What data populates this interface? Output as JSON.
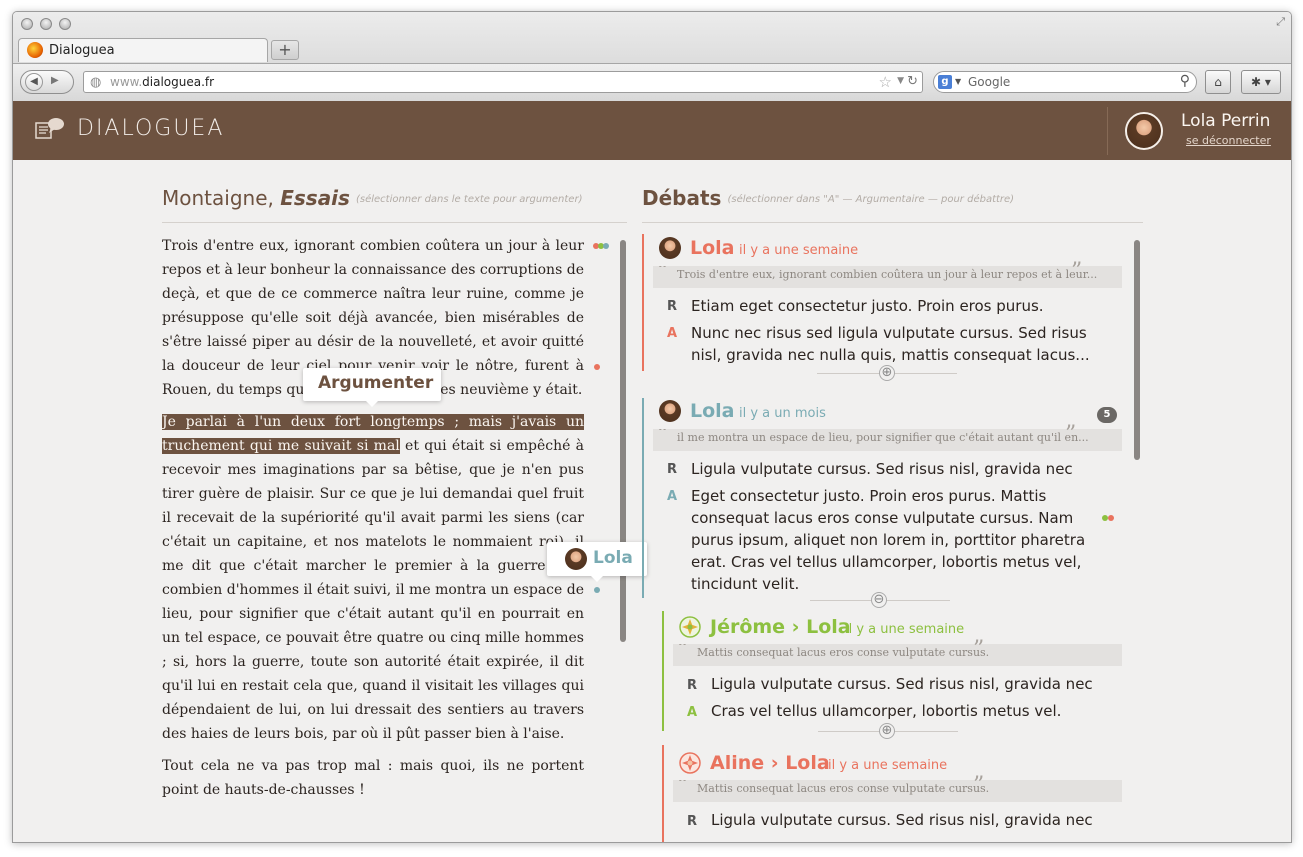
{
  "browser": {
    "tab_title": "Dialoguea",
    "new_tab": "+",
    "url_prefix": "www.",
    "url_host": "dialoguea.fr",
    "search_placeholder": "Google",
    "search_engine_letter": "g"
  },
  "app": {
    "brand": "DIALOGUEA",
    "user_name": "Lola Perrin",
    "logout": "se déconnecter"
  },
  "left": {
    "title_author": "Montaigne, ",
    "title_work": "Essais",
    "hint": "(sélectionner dans le texte pour argumenter)",
    "p1": "Trois d'entre eux, ignorant combien coûtera un jour à leur repos et à leur bonheur la connaissance des corruptions de deçà, et que de ce commerce naîtra leur ruine, comme je présuppose qu'elle soit déjà avancée, bien misérables de s'être laissé piper au désir de la nouvelleté, et avoir quitté la douceur de leur ciel pour venir voir le nôtre, furent à Rouen, du temps que leur feu roi Charles neuvième y était.",
    "p2_highlight": "Je parlai à l'un deux fort longtemps ; mais j'avais un truchement qui me suivait si mal",
    "p2_rest": " et qui était si empêché à recevoir mes imaginations par sa bêtise, que je n'en pus tirer guère de plaisir. Sur ce que je lui demandai quel fruit il recevait de la supériorité qu'il avait parmi les siens (car c'était un capitaine, et nos matelots le nommaient roi), il me dit que c'était marcher le premier à la guerre ; de combien d'hommes il était suivi, il me montra un espace de lieu, pour signifier que c'était autant qu'il en pourrait en un tel espace, ce pouvait être quatre ou cinq mille hommes ; si, hors la guerre, toute son autorité était expirée, il dit qu'il lui en restait cela que, quand il visitait les villages qui dépendaient de lui, on lui dressait des sentiers au travers des haies de leurs bois, par où il pût passer bien à l'aise.",
    "p3": "Tout cela ne va pas trop mal : mais quoi, ils ne portent point de hauts-de-chausses !",
    "tip_argumenter": "Argumenter",
    "tip_lola": "Lola"
  },
  "right": {
    "title": "Débats",
    "hint": "(sélectionner dans \"A\" — Argumentaire — pour débattre)",
    "debates": [
      {
        "name": "Lola",
        "time": "il y a une semaine",
        "quote": "Trois d'entre eux, ignorant combien coûtera un jour à leur repos et à leur...",
        "r": "Etiam eget consectetur justo. Proin eros purus.",
        "a": "Nunc nec risus sed ligula vulputate cursus. Sed risus nisl, gravida nec nulla quis, mattis consequat lacus..."
      },
      {
        "name": "Lola",
        "time": "il y a un mois",
        "badge": "5",
        "quote": "il me montra un espace de lieu, pour signifier que c'était autant qu'il en...",
        "r": "Ligula vulputate cursus. Sed risus nisl, gravida nec",
        "a": "Eget consectetur justo. Proin eros purus. Mattis consequat lacus eros conse vulputate cursus. Nam purus ipsum, aliquet non lorem in, porttitor pharetra erat. Cras vel tellus ullamcorper, lobortis metus vel, tincidunt velit."
      },
      {
        "name": "Jérôme › Lola",
        "time": "il y a une semaine",
        "quote": "Mattis consequat lacus eros conse vulputate cursus.",
        "r": "Ligula vulputate cursus. Sed risus nisl, gravida nec",
        "a": "Cras vel tellus ullamcorper, lobortis metus vel."
      },
      {
        "name": "Aline › Lola",
        "time": "il y a une semaine",
        "quote": "Mattis consequat lacus eros conse vulputate cursus.",
        "r": "Ligula vulputate cursus. Sed risus nisl, gravida nec"
      }
    ],
    "label_r": "R",
    "label_a": "A",
    "plus": "⊕",
    "minus": "⊖",
    "quote_close": "”",
    "quote_open": "“"
  },
  "colors": {
    "brand": "#6d5240",
    "red": "#e9735e",
    "teal": "#7aabb3",
    "green": "#8dc040"
  },
  "icons": {
    "back": "back-arrow-icon",
    "forward": "forward-arrow-icon",
    "globe": "globe-icon",
    "star": "bookmark-star-icon",
    "reload": "reload-icon",
    "search": "magnifier-icon",
    "home": "home-icon",
    "addon": "addon-icon"
  }
}
